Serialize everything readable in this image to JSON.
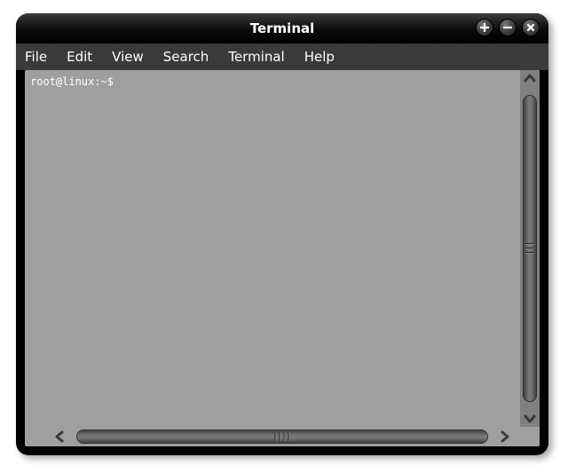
{
  "window": {
    "title": "Terminal"
  },
  "menubar": {
    "items": [
      "File",
      "Edit",
      "View",
      "Search",
      "Terminal",
      "Help"
    ]
  },
  "terminal": {
    "prompt": "root@linux:~$ "
  }
}
